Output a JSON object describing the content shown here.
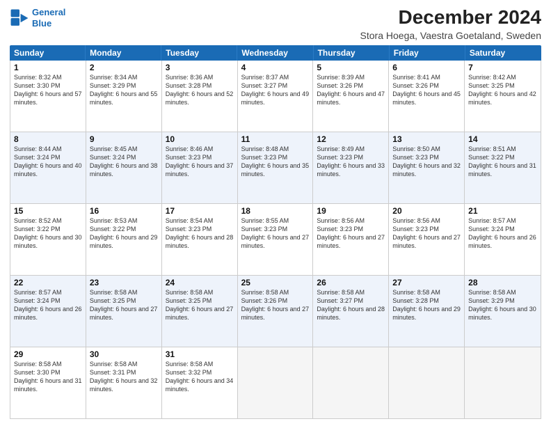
{
  "header": {
    "logo": {
      "line1": "General",
      "line2": "Blue"
    },
    "title": "December 2024",
    "subtitle": "Stora Hoega, Vaestra Goetaland, Sweden"
  },
  "calendar": {
    "days_of_week": [
      "Sunday",
      "Monday",
      "Tuesday",
      "Wednesday",
      "Thursday",
      "Friday",
      "Saturday"
    ],
    "weeks": [
      [
        {
          "day": "1",
          "sunrise": "8:32 AM",
          "sunset": "3:30 PM",
          "daylight": "6 hours and 57 minutes."
        },
        {
          "day": "2",
          "sunrise": "8:34 AM",
          "sunset": "3:29 PM",
          "daylight": "6 hours and 55 minutes."
        },
        {
          "day": "3",
          "sunrise": "8:36 AM",
          "sunset": "3:28 PM",
          "daylight": "6 hours and 52 minutes."
        },
        {
          "day": "4",
          "sunrise": "8:37 AM",
          "sunset": "3:27 PM",
          "daylight": "6 hours and 49 minutes."
        },
        {
          "day": "5",
          "sunrise": "8:39 AM",
          "sunset": "3:26 PM",
          "daylight": "6 hours and 47 minutes."
        },
        {
          "day": "6",
          "sunrise": "8:41 AM",
          "sunset": "3:26 PM",
          "daylight": "6 hours and 45 minutes."
        },
        {
          "day": "7",
          "sunrise": "8:42 AM",
          "sunset": "3:25 PM",
          "daylight": "6 hours and 42 minutes."
        }
      ],
      [
        {
          "day": "8",
          "sunrise": "8:44 AM",
          "sunset": "3:24 PM",
          "daylight": "6 hours and 40 minutes."
        },
        {
          "day": "9",
          "sunrise": "8:45 AM",
          "sunset": "3:24 PM",
          "daylight": "6 hours and 38 minutes."
        },
        {
          "day": "10",
          "sunrise": "8:46 AM",
          "sunset": "3:23 PM",
          "daylight": "6 hours and 37 minutes."
        },
        {
          "day": "11",
          "sunrise": "8:48 AM",
          "sunset": "3:23 PM",
          "daylight": "6 hours and 35 minutes."
        },
        {
          "day": "12",
          "sunrise": "8:49 AM",
          "sunset": "3:23 PM",
          "daylight": "6 hours and 33 minutes."
        },
        {
          "day": "13",
          "sunrise": "8:50 AM",
          "sunset": "3:23 PM",
          "daylight": "6 hours and 32 minutes."
        },
        {
          "day": "14",
          "sunrise": "8:51 AM",
          "sunset": "3:22 PM",
          "daylight": "6 hours and 31 minutes."
        }
      ],
      [
        {
          "day": "15",
          "sunrise": "8:52 AM",
          "sunset": "3:22 PM",
          "daylight": "6 hours and 30 minutes."
        },
        {
          "day": "16",
          "sunrise": "8:53 AM",
          "sunset": "3:22 PM",
          "daylight": "6 hours and 29 minutes."
        },
        {
          "day": "17",
          "sunrise": "8:54 AM",
          "sunset": "3:23 PM",
          "daylight": "6 hours and 28 minutes."
        },
        {
          "day": "18",
          "sunrise": "8:55 AM",
          "sunset": "3:23 PM",
          "daylight": "6 hours and 27 minutes."
        },
        {
          "day": "19",
          "sunrise": "8:56 AM",
          "sunset": "3:23 PM",
          "daylight": "6 hours and 27 minutes."
        },
        {
          "day": "20",
          "sunrise": "8:56 AM",
          "sunset": "3:23 PM",
          "daylight": "6 hours and 27 minutes."
        },
        {
          "day": "21",
          "sunrise": "8:57 AM",
          "sunset": "3:24 PM",
          "daylight": "6 hours and 26 minutes."
        }
      ],
      [
        {
          "day": "22",
          "sunrise": "8:57 AM",
          "sunset": "3:24 PM",
          "daylight": "6 hours and 26 minutes."
        },
        {
          "day": "23",
          "sunrise": "8:58 AM",
          "sunset": "3:25 PM",
          "daylight": "6 hours and 27 minutes."
        },
        {
          "day": "24",
          "sunrise": "8:58 AM",
          "sunset": "3:25 PM",
          "daylight": "6 hours and 27 minutes."
        },
        {
          "day": "25",
          "sunrise": "8:58 AM",
          "sunset": "3:26 PM",
          "daylight": "6 hours and 27 minutes."
        },
        {
          "day": "26",
          "sunrise": "8:58 AM",
          "sunset": "3:27 PM",
          "daylight": "6 hours and 28 minutes."
        },
        {
          "day": "27",
          "sunrise": "8:58 AM",
          "sunset": "3:28 PM",
          "daylight": "6 hours and 29 minutes."
        },
        {
          "day": "28",
          "sunrise": "8:58 AM",
          "sunset": "3:29 PM",
          "daylight": "6 hours and 30 minutes."
        }
      ],
      [
        {
          "day": "29",
          "sunrise": "8:58 AM",
          "sunset": "3:30 PM",
          "daylight": "6 hours and 31 minutes."
        },
        {
          "day": "30",
          "sunrise": "8:58 AM",
          "sunset": "3:31 PM",
          "daylight": "6 hours and 32 minutes."
        },
        {
          "day": "31",
          "sunrise": "8:58 AM",
          "sunset": "3:32 PM",
          "daylight": "6 hours and 34 minutes."
        },
        null,
        null,
        null,
        null
      ]
    ]
  }
}
